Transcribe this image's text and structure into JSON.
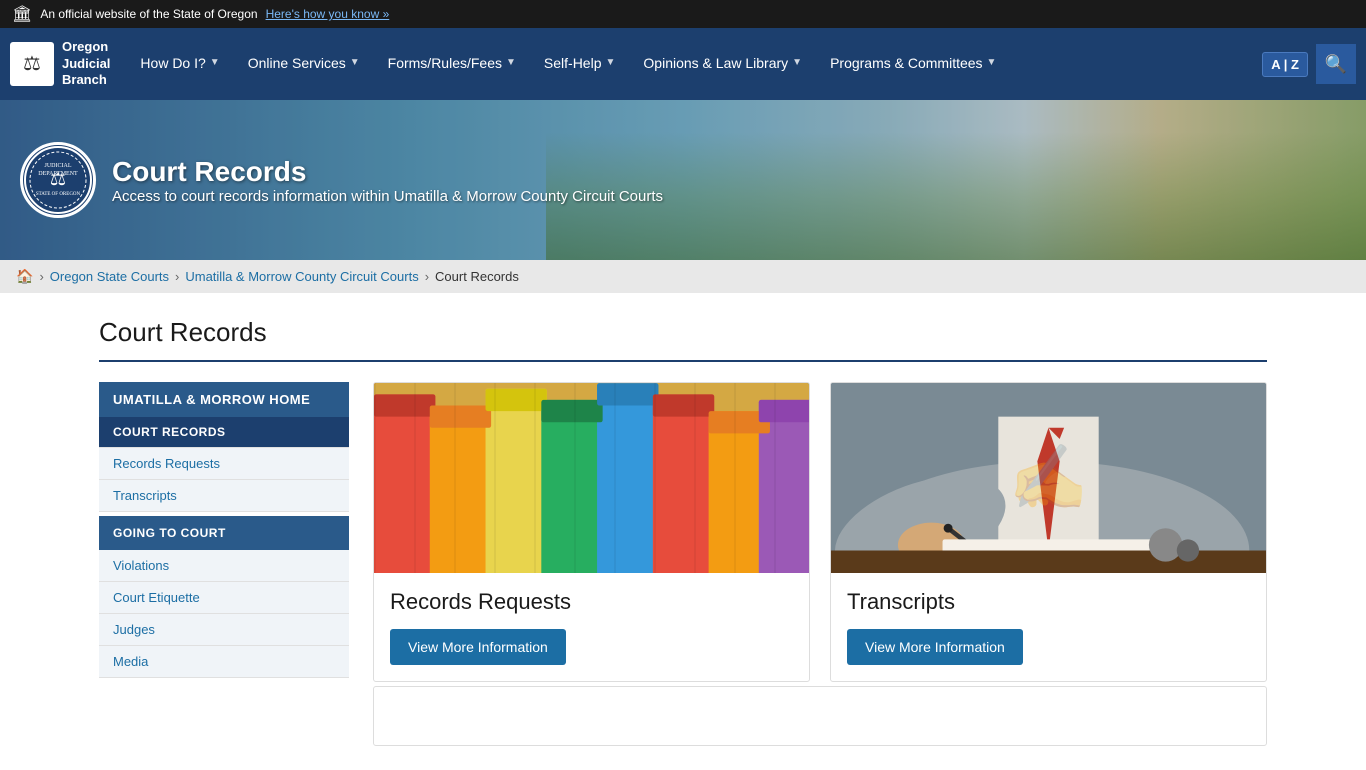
{
  "topbar": {
    "flag": "🏛",
    "text": "An official website of the State of Oregon",
    "link_text": "Here's how you know »"
  },
  "nav": {
    "logo_text": "Oregon\nJudicial\nBranch",
    "logo_icon": "⚖",
    "items": [
      {
        "label": "How Do I?",
        "has_dropdown": true
      },
      {
        "label": "Online Services",
        "has_dropdown": true
      },
      {
        "label": "Forms/Rules/Fees",
        "has_dropdown": true
      },
      {
        "label": "Self-Help",
        "has_dropdown": true
      },
      {
        "label": "Opinions & Law Library",
        "has_dropdown": true
      },
      {
        "label": "Programs & Committees",
        "has_dropdown": true
      }
    ],
    "translate_label": "A | Z",
    "search_icon": "🔍"
  },
  "hero": {
    "title": "Court Records",
    "subtitle": "Access to court records information within Umatilla & Morrow County Circuit Courts",
    "seal_text": "JUDICIAL DEPARTMENT STATE OF OREGON"
  },
  "breadcrumb": {
    "home_icon": "🏠",
    "items": [
      {
        "label": "Oregon State Courts",
        "link": true
      },
      {
        "label": "Umatilla & Morrow County Circuit Courts",
        "link": true
      },
      {
        "label": "Court Records",
        "link": false
      }
    ]
  },
  "page_title": "Court Records",
  "sidebar": {
    "section1_label": "UMATILLA & MORROW HOME",
    "active_item_label": "COURT RECORDS",
    "items_court": [
      {
        "label": "Records Requests"
      },
      {
        "label": "Transcripts"
      }
    ],
    "section2_label": "GOING TO COURT",
    "items_court2": [
      {
        "label": "Violations"
      },
      {
        "label": "Court Etiquette"
      },
      {
        "label": "Judges"
      },
      {
        "label": "Media"
      }
    ]
  },
  "cards": [
    {
      "id": "records-requests",
      "title": "Records Requests",
      "btn_label": "View More Information",
      "img_type": "folders"
    },
    {
      "id": "transcripts",
      "title": "Transcripts",
      "btn_label": "View More Information",
      "img_type": "signing"
    }
  ]
}
